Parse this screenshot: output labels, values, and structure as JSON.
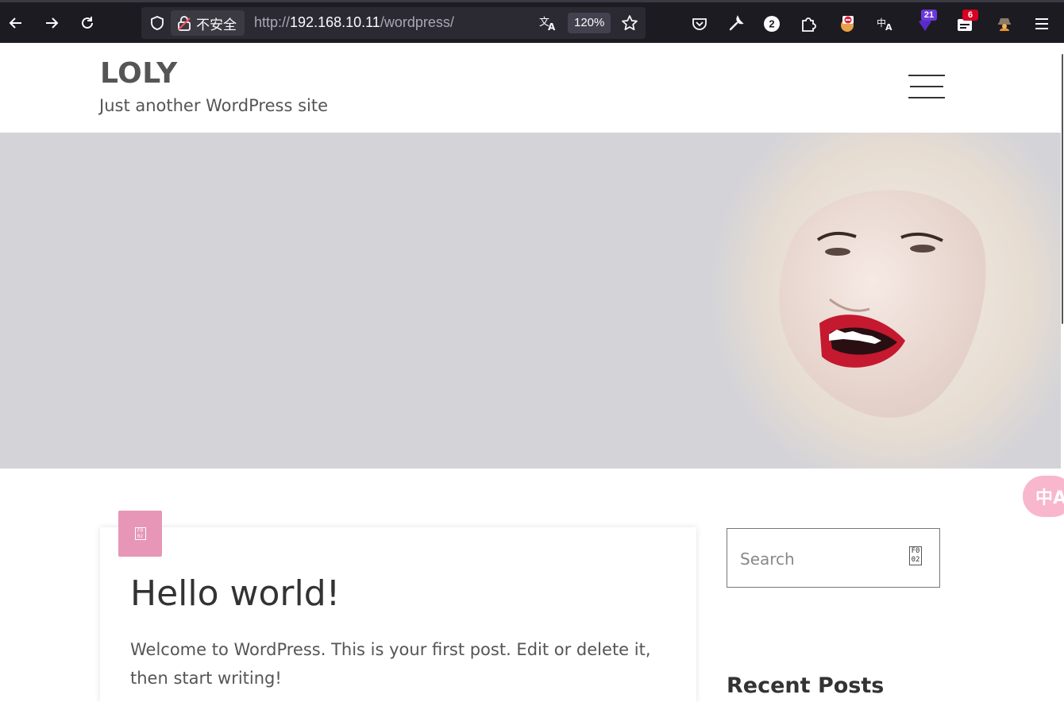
{
  "browser": {
    "security_label": "不安全",
    "url_prefix": "http://",
    "url_host": "192.168.10.11",
    "url_path": "/wordpress/",
    "zoom": "120%",
    "extensions": [
      {
        "name": "pocket",
        "badge": ""
      },
      {
        "name": "wrench",
        "badge": ""
      },
      {
        "name": "counter",
        "badge": "2"
      },
      {
        "name": "puzzle",
        "badge": ""
      },
      {
        "name": "blocker",
        "badge": ""
      },
      {
        "name": "translate",
        "badge": ""
      },
      {
        "name": "shield",
        "badge": "21"
      },
      {
        "name": "calendar",
        "badge": "6"
      },
      {
        "name": "spy",
        "badge": ""
      }
    ],
    "colors": {
      "chrome_bg": "#1c1b22",
      "urlbar_bg": "#2b2a33",
      "badge_purple": "#6a3ad8",
      "badge_red": "#d70022"
    }
  },
  "site": {
    "title": "LOLY",
    "tagline": "Just another WordPress site"
  },
  "hero": {
    "bg_color": "#d3d3d8"
  },
  "post": {
    "format_icon": "standard-post-icon",
    "format_glyph": "F0 02",
    "accent": "#e796b8",
    "title": "Hello world!",
    "excerpt": "Welcome to WordPress. This is your first post. Edit or delete it, then start writing!"
  },
  "sidebar": {
    "search_placeholder": "Search",
    "search_glyph": "F0 02",
    "recent_posts_title": "Recent Posts"
  },
  "translate_fab": {
    "label": "中A"
  }
}
